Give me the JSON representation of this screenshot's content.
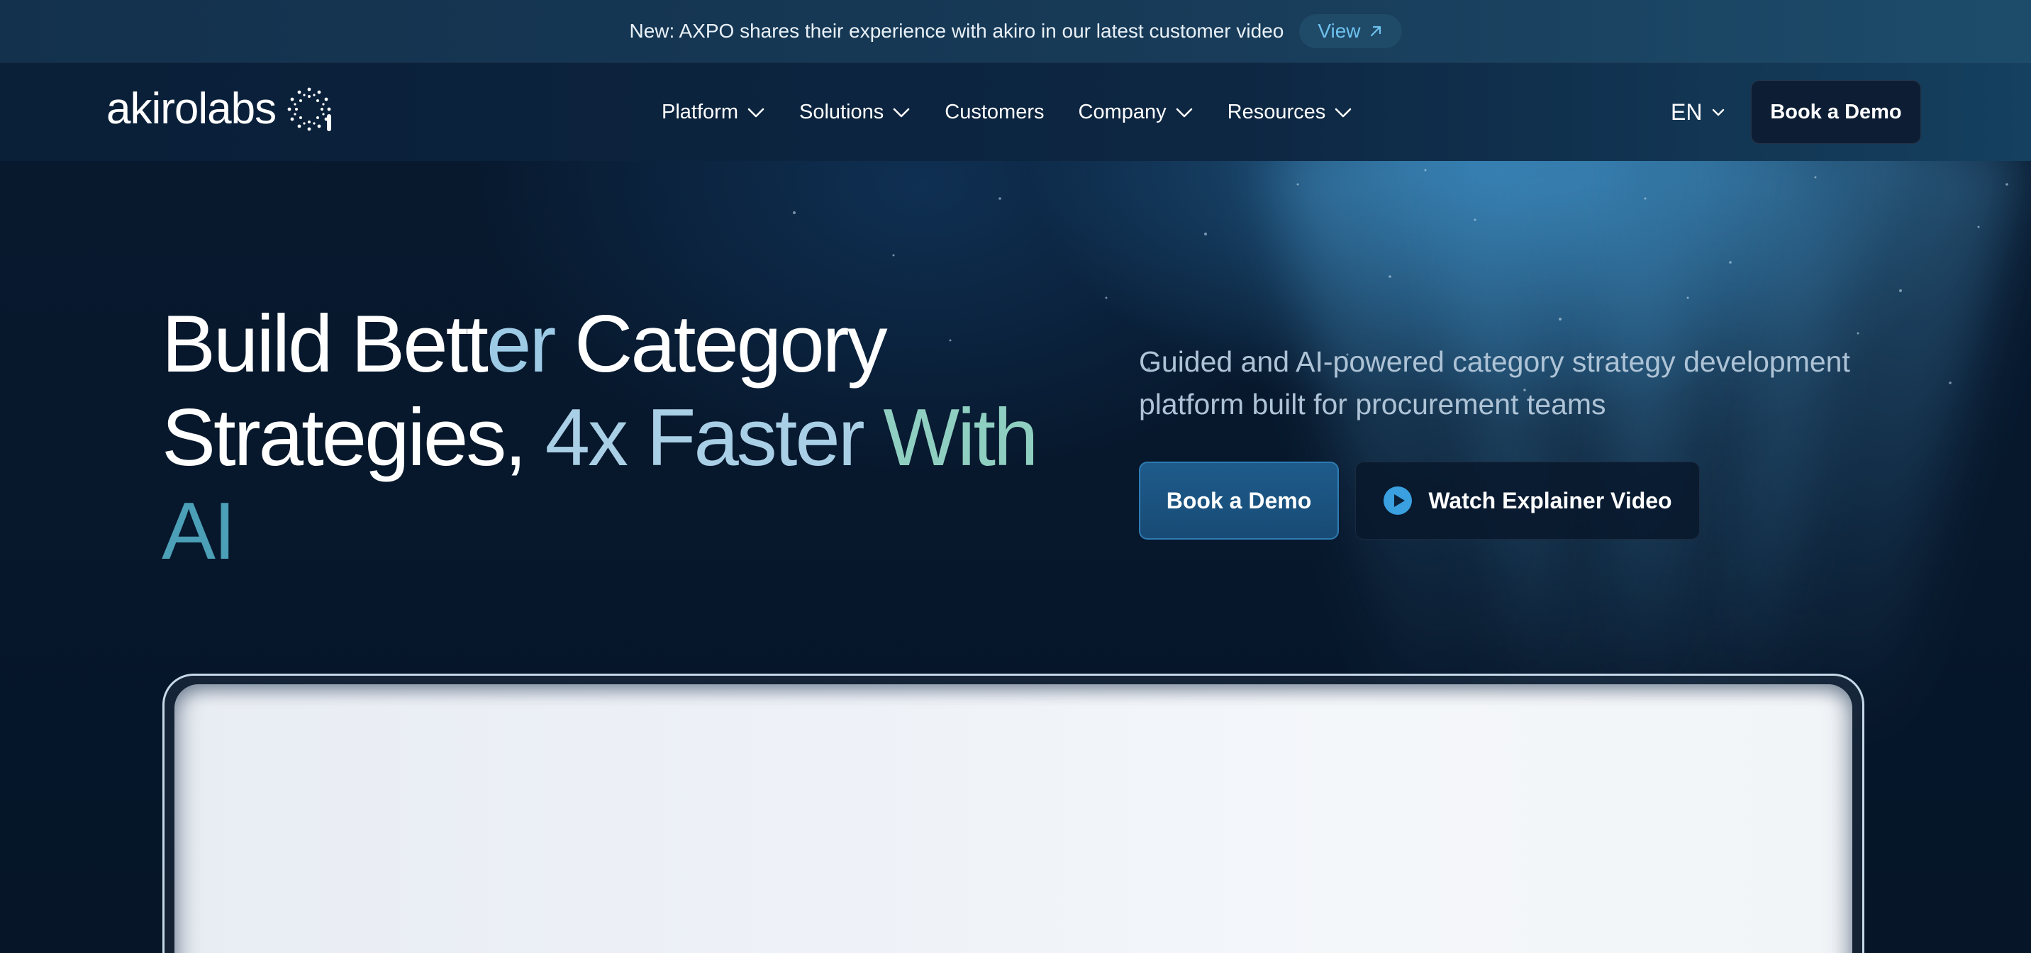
{
  "announcement": {
    "text": "New: AXPO shares their experience with akiro in our latest customer video",
    "link_label": "View",
    "link_icon": "arrow-up-right-icon"
  },
  "nav": {
    "logo_text": "akirolabs",
    "logo_icon": "dotted-ring-logo-icon",
    "items": [
      {
        "label": "Platform",
        "has_dropdown": true
      },
      {
        "label": "Solutions",
        "has_dropdown": true
      },
      {
        "label": "Customers",
        "has_dropdown": false
      },
      {
        "label": "Company",
        "has_dropdown": true
      },
      {
        "label": "Resources",
        "has_dropdown": true
      }
    ],
    "language": "EN",
    "cta_label": "Book a Demo"
  },
  "hero": {
    "headline": {
      "part1": "Build Bett",
      "part2": "er",
      "part3": " Category",
      "part4": "Strategies, ",
      "part5": "4x Faster ",
      "part6": "With",
      "part7": "AI"
    },
    "subtitle": "Guided and AI-powered category strategy development platform built for procurement teams",
    "primary_cta": "Book a Demo",
    "secondary_cta": "Watch Explainer Video",
    "secondary_icon": "play-circle-icon"
  },
  "colors": {
    "background": "#06162b",
    "accent": "#3aa0e0",
    "announce_link": "#6ec2ef",
    "headline_teal": "#8fcfc1",
    "headline_ai": "#4b9fb6"
  }
}
